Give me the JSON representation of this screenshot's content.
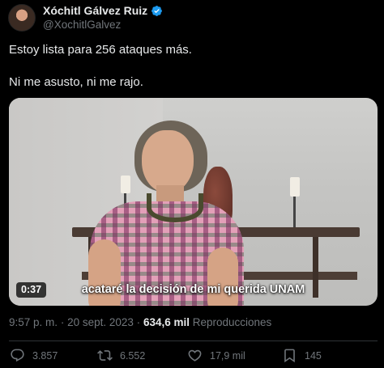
{
  "author": {
    "display_name": "Xóchitl Gálvez Ruiz",
    "handle": "@XochitlGalvez",
    "verified": true,
    "verified_color": "#1d9bf0"
  },
  "tweet": {
    "lines": [
      "Estoy lista para 256 ataques más.",
      "Ni me asusto, ni me rajo."
    ]
  },
  "video": {
    "duration": "0:37",
    "caption": "acataré la decisión de mi querida UNAM"
  },
  "meta": {
    "time": "9:57 p. m.",
    "separator1": "·",
    "date": "20 sept. 2023",
    "separator2": "·",
    "views": "634,6 mil",
    "views_label": "Reproducciones"
  },
  "actions": {
    "replies": {
      "icon": "reply-icon",
      "count": "3.857"
    },
    "reposts": {
      "icon": "repost-icon",
      "count": "6.552"
    },
    "likes": {
      "icon": "heart-icon",
      "count": "17,9 mil"
    },
    "bookmarks": {
      "icon": "bookmark-icon",
      "count": "145"
    }
  },
  "colors": {
    "background": "#000000",
    "text": "#e7e9ea",
    "muted": "#71767b"
  }
}
